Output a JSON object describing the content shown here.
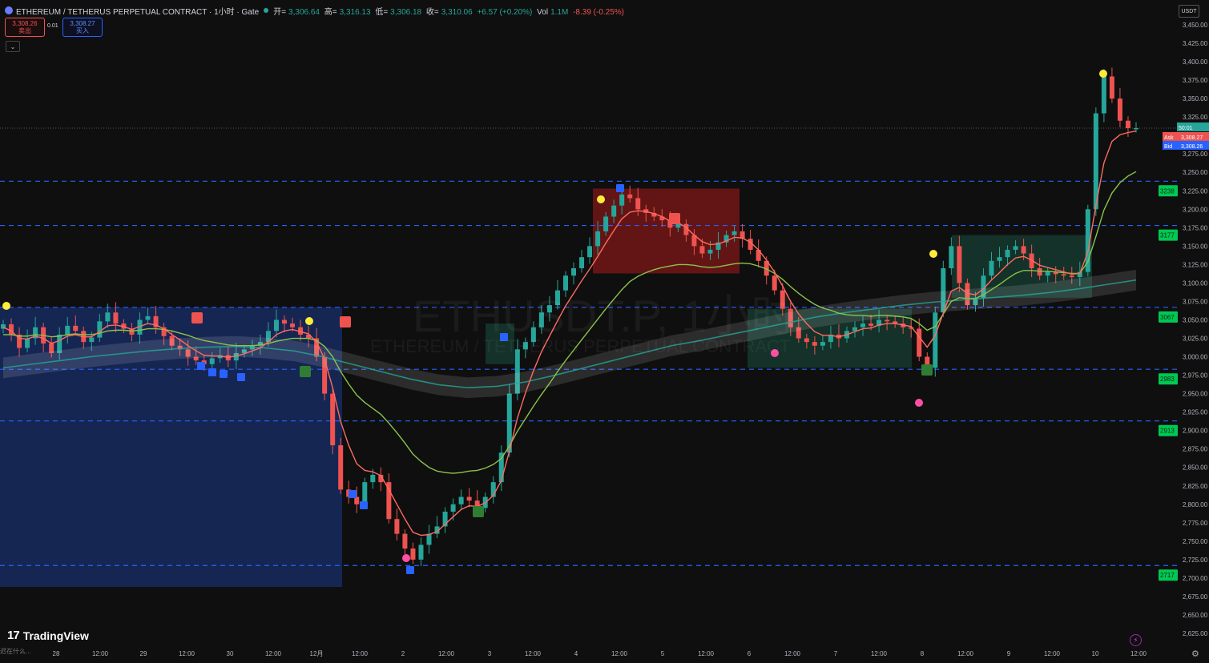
{
  "header": {
    "title": "ETHEREUM / TETHERUS PERPETUAL CONTRACT · 1小时 · Gate",
    "ohlc": [
      {
        "label": "开=",
        "value": "3,306.64"
      },
      {
        "label": "高=",
        "value": "3,316.13"
      },
      {
        "label": "低=",
        "value": "3,306.18"
      },
      {
        "label": "收=",
        "value": "3,310.06"
      }
    ],
    "change": "+6.57 (+0.20%)",
    "vol_label": "Vol",
    "vol_value": "1.1M",
    "vol_change": "-8.39 (-0.25%)"
  },
  "trade": {
    "sell_price": "3,308.26",
    "sell_label": "卖出",
    "spread": "0.01",
    "buy_price": "3,308.27",
    "buy_label": "买入"
  },
  "controls": {
    "collapse_icon": "chevron-down-icon",
    "collapse_glyph": "⌄",
    "currency": "USDT",
    "settings_glyph": "⚙",
    "bolt_glyph": "⚡"
  },
  "branding": {
    "logo_text": "TradingView",
    "logo_mark": "17"
  },
  "watermark": {
    "big": "ETHUSDT.P, 1小时",
    "small": "ETHEREUM / TETHERUS PERPETUAL CONTRACT"
  },
  "bottom_note": "迟在什么...",
  "colors": {
    "up": "#26a69a",
    "down": "#ef5350",
    "ema_fast": "#ff6b5f",
    "ema_slow": "#8bc34a",
    "level_line": "#2962ff",
    "demand_zone": "#1e3a8a",
    "supply_zone": "#b71c1c",
    "bg": "#0f0f0f"
  },
  "chart_data": {
    "type": "candlestick",
    "symbol": "ETHUSDT.P",
    "interval": "1小时",
    "yaxis": {
      "ticks": [
        "3,450.00",
        "3,425.00",
        "3,400.00",
        "3,375.00",
        "3,350.00",
        "3,325.00",
        "3,300.00",
        "3,275.00",
        "3,250.00",
        "3,225.00",
        "3,200.00",
        "3,175.00",
        "3,150.00",
        "3,125.00",
        "3,100.00",
        "3,075.00",
        "3,050.00",
        "3,025.00",
        "3,000.00",
        "2,975.00",
        "2,950.00",
        "2,925.00",
        "2,900.00",
        "2,875.00",
        "2,850.00",
        "2,825.00",
        "2,800.00",
        "2,775.00",
        "2,750.00",
        "2,725.00",
        "2,700.00",
        "2,675.00",
        "2,650.00",
        "2,625.00"
      ],
      "range": [
        2610,
        3468
      ]
    },
    "xaxis": {
      "ticks": [
        "28",
        "12:00",
        "29",
        "12:00",
        "30",
        "12:00",
        "12月",
        "12:00",
        "2",
        "12:00",
        "3",
        "12:00",
        "4",
        "12:00",
        "5",
        "12:00",
        "6",
        "12:00",
        "7",
        "12:00",
        "8",
        "12:00",
        "9",
        "12:00",
        "10",
        "12:00"
      ],
      "range": [
        27.4,
        10.5
      ]
    },
    "price_tags": [
      {
        "label": "50:01",
        "value": 3310,
        "type": "countdown"
      },
      {
        "label": "Ask",
        "price": "3,308.27",
        "value": 3308.27,
        "type": "ask"
      },
      {
        "label": "Bid",
        "price": "3,308.26",
        "value": 3308.26,
        "type": "bid"
      }
    ],
    "levels": [
      {
        "label": "3238",
        "value": 3238
      },
      {
        "label": "3177",
        "value": 3178
      },
      {
        "label": "3067",
        "value": 3067
      },
      {
        "label": "2983",
        "value": 2983
      },
      {
        "label": "2913",
        "value": 2913
      },
      {
        "label": "2717",
        "value": 2717
      }
    ],
    "series": [
      {
        "name": "close",
        "values": [
          3044,
          3030,
          3012,
          3025,
          3040,
          3018,
          3005,
          3030,
          3042,
          3035,
          3020,
          3026,
          3048,
          3060,
          3045,
          3038,
          3030,
          3050,
          3055,
          3040,
          3028,
          3015,
          3010,
          3000,
          2995,
          2990,
          2998,
          3002,
          2995,
          3005,
          3010,
          3015,
          3020,
          3035,
          3050,
          3045,
          3040,
          3030,
          3025,
          3000,
          2950,
          2880,
          2820,
          2810,
          2800,
          2830,
          2840,
          2830,
          2780,
          2760,
          2740,
          2725,
          2745,
          2760,
          2770,
          2790,
          2800,
          2810,
          2805,
          2795,
          2810,
          2830,
          2870,
          2950,
          3010,
          3020,
          3040,
          3060,
          3070,
          3090,
          3110,
          3120,
          3135,
          3150,
          3170,
          3190,
          3205,
          3220,
          3215,
          3200,
          3195,
          3190,
          3185,
          3175,
          3180,
          3165,
          3150,
          3140,
          3145,
          3155,
          3165,
          3170,
          3160,
          3145,
          3130,
          3110,
          3090,
          3065,
          3040,
          3025,
          3020,
          3015,
          3020,
          3030,
          3025,
          3035,
          3040,
          3045,
          3042,
          3050,
          3048,
          3045,
          3040,
          3038,
          3000,
          2985,
          3060,
          3120,
          3150,
          3100,
          3070,
          3080,
          3110,
          3130,
          3135,
          3145,
          3150,
          3140,
          3120,
          3110,
          3115,
          3112,
          3110,
          3108,
          3115,
          3200,
          3330,
          3380,
          3350,
          3320,
          3310,
          3310
        ]
      },
      {
        "name": "ema_fast",
        "values": [
          3040,
          3035,
          3025,
          3024,
          3028,
          3025,
          3018,
          3022,
          3028,
          3030,
          3027,
          3027,
          3034,
          3042,
          3043,
          3041,
          3037,
          3041,
          3045,
          3043,
          3038,
          3030,
          3023,
          3015,
          3008,
          3002,
          3001,
          3001,
          2999,
          3001,
          3004,
          3008,
          3012,
          3020,
          3030,
          3035,
          3037,
          3034,
          3031,
          3020,
          2997,
          2958,
          2912,
          2880,
          2855,
          2846,
          2844,
          2839,
          2820,
          2800,
          2780,
          2762,
          2758,
          2759,
          2763,
          2773,
          2783,
          2793,
          2798,
          2797,
          2802,
          2812,
          2832,
          2872,
          2917,
          2951,
          2981,
          3007,
          3028,
          3049,
          3069,
          3086,
          3103,
          3119,
          3136,
          3154,
          3171,
          3187,
          3196,
          3198,
          3197,
          3194,
          3190,
          3184,
          3182,
          3175,
          3165,
          3156,
          3152,
          3153,
          3157,
          3162,
          3161,
          3155,
          3145,
          3131,
          3115,
          3096,
          3075,
          3058,
          3045,
          3034,
          3029,
          3029,
          3027,
          3030,
          3034,
          3038,
          3039,
          3043,
          3045,
          3045,
          3043,
          3041,
          3027,
          3013,
          3029,
          3059,
          3089,
          3094,
          3086,
          3084,
          3092,
          3104,
          3114,
          3125,
          3134,
          3136,
          3131,
          3124,
          3121,
          3118,
          3115,
          3112,
          3113,
          3142,
          3205,
          3263,
          3292,
          3301,
          3304,
          3306
        ]
      },
      {
        "name": "ema_slow",
        "values": [
          3030,
          3030,
          3028,
          3028,
          3030,
          3029,
          3027,
          3028,
          3030,
          3031,
          3030,
          3030,
          3032,
          3035,
          3036,
          3036,
          3035,
          3036,
          3038,
          3038,
          3037,
          3035,
          3032,
          3029,
          3025,
          3022,
          3020,
          3018,
          3016,
          3015,
          3015,
          3015,
          3016,
          3018,
          3021,
          3023,
          3025,
          3025,
          3025,
          3022,
          3014,
          3000,
          2980,
          2963,
          2948,
          2938,
          2930,
          2922,
          2910,
          2897,
          2883,
          2868,
          2858,
          2850,
          2845,
          2843,
          2842,
          2843,
          2845,
          2846,
          2849,
          2854,
          2862,
          2879,
          2899,
          2916,
          2933,
          2949,
          2964,
          2980,
          2995,
          3009,
          3023,
          3037,
          3051,
          3065,
          3078,
          3091,
          3102,
          3109,
          3114,
          3118,
          3121,
          3123,
          3125,
          3125,
          3124,
          3122,
          3121,
          3122,
          3124,
          3126,
          3127,
          3126,
          3123,
          3119,
          3113,
          3105,
          3095,
          3086,
          3078,
          3071,
          3066,
          3063,
          3059,
          3057,
          3056,
          3056,
          3055,
          3056,
          3056,
          3055,
          3054,
          3052,
          3045,
          3036,
          3041,
          3058,
          3075,
          3080,
          3079,
          3079,
          3084,
          3091,
          3098,
          3106,
          3113,
          3117,
          3117,
          3116,
          3116,
          3115,
          3114,
          3113,
          3113,
          3129,
          3163,
          3199,
          3222,
          3236,
          3245,
          3251
        ]
      },
      {
        "name": "trend_band",
        "values": [
          2985,
          2990,
          2995,
          3000,
          3004,
          3008,
          3011,
          3013,
          3014,
          3012,
          3008,
          3000,
          2990,
          2980,
          2970,
          2962,
          2958,
          2960,
          2966,
          2975,
          2985,
          2995,
          3005,
          3015,
          3022,
          3030,
          3038,
          3046,
          3054,
          3060,
          3065,
          3070,
          3074,
          3077,
          3080,
          3083,
          3087,
          3092,
          3098,
          3104
        ]
      }
    ],
    "zones": [
      {
        "type": "demand",
        "from": 27.4,
        "to": 1.0,
        "low": 2688,
        "high": 3067
      },
      {
        "type": "supply",
        "from": 4.2,
        "to": 5.85,
        "low": 3113,
        "high": 3228
      },
      {
        "type": "consolidation",
        "from": 3.0,
        "to": 3.35,
        "low": 2990,
        "high": 3045
      },
      {
        "type": "consolidation",
        "from": 5.95,
        "to": 8.05,
        "low": 2985,
        "high": 3065
      },
      {
        "type": "consolidation",
        "from": 8.9,
        "to": 10.0,
        "low": 3080,
        "high": 3165
      }
    ]
  }
}
